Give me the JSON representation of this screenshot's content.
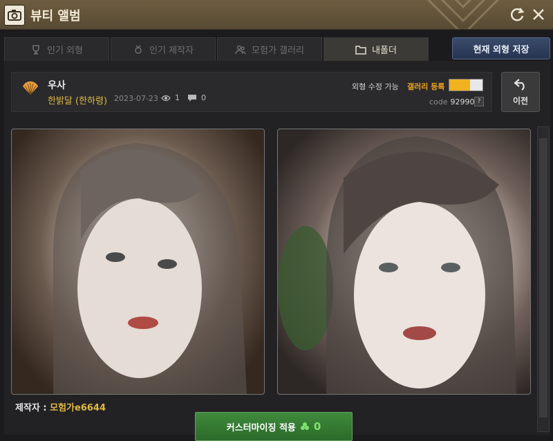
{
  "window": {
    "title": "뷰티 앨범"
  },
  "tabs": [
    {
      "label": "인기 외형",
      "icon": "trophy-icon",
      "active": false
    },
    {
      "label": "인기 제작자",
      "icon": "medal-icon",
      "active": false
    },
    {
      "label": "모험가 갤러리",
      "icon": "people-icon",
      "active": false
    },
    {
      "label": "내폴더",
      "icon": "folder-icon",
      "active": true
    }
  ],
  "save_button": {
    "label": "현재 외형 저장"
  },
  "info": {
    "user_name": "우사",
    "character_name": "한밝달 (한하령)",
    "date": "2023-07-23",
    "views": "1",
    "comments": "0",
    "edit_label": "외형 수정 가능",
    "gallery_label": "갤러리 등록",
    "code_label": "code",
    "code_value": "929901",
    "help": "?"
  },
  "back_button": {
    "label": "이전"
  },
  "creator": {
    "label": "제작자 : ",
    "name": "모험가e6644"
  },
  "apply_button": {
    "label": "커스터마이징 적용",
    "count": "0"
  },
  "colors": {
    "accent_gold": "#e0b845",
    "gallery_orange": "#f0a31f",
    "apply_green": "#3f8a3c"
  }
}
